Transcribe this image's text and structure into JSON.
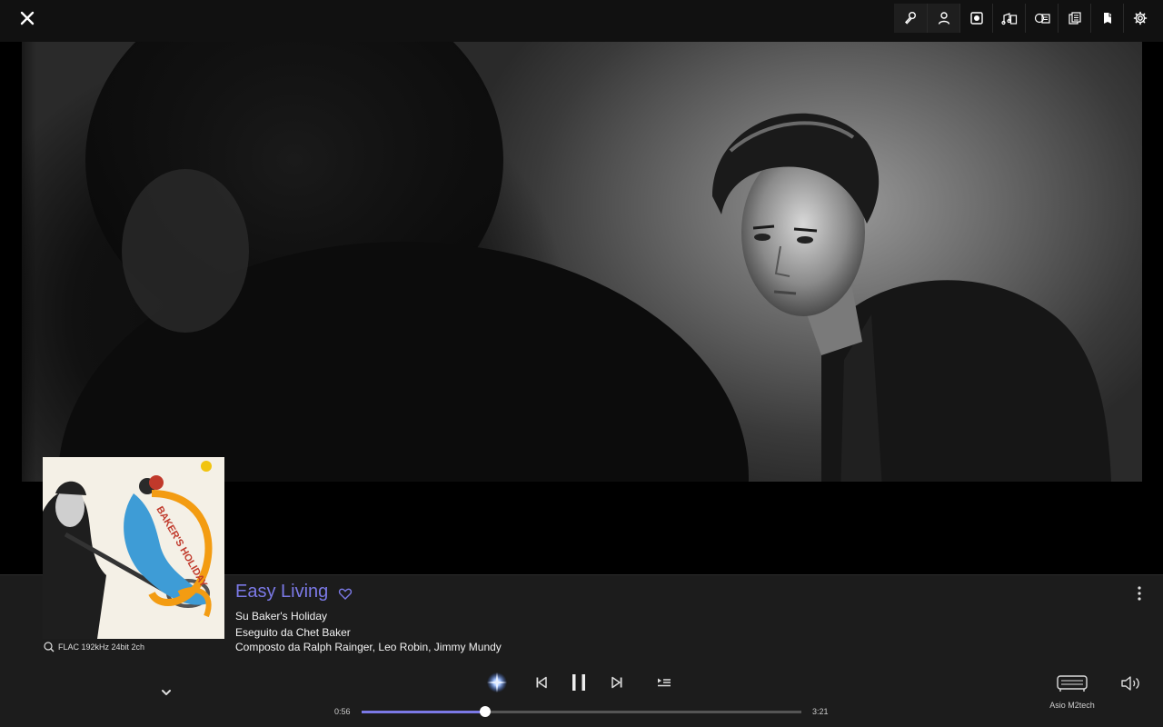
{
  "track": {
    "title": "Easy Living",
    "album_line": "Su Baker's Holiday",
    "performer_line": "Eseguito da Chet Baker",
    "composer_line": "Composto da Ralph Rainger, Leo Robin, Jimmy Mundy"
  },
  "quality": {
    "label": "FLAC 192kHz 24bit 2ch"
  },
  "playback": {
    "elapsed": "0:56",
    "duration": "3:21",
    "progress": 0.28
  },
  "output": {
    "label": "Asio M2tech"
  },
  "cover": {
    "art_text": "BAKER'S HOLIDAY"
  },
  "icons": {
    "close": "close-icon",
    "toolbar": [
      "microphone-icon",
      "person-icon",
      "album-icon",
      "music-notes-icon",
      "credits-icon",
      "lyrics-icon",
      "bookmark-icon",
      "gear-icon"
    ],
    "favorite": "heart-icon",
    "more": "more-vertical-icon",
    "collapse": "chevron-down-icon",
    "radio": "radio-sparkle-icon",
    "previous": "skip-previous-icon",
    "pause": "pause-icon",
    "next": "skip-next-icon",
    "queue": "queue-icon",
    "output": "speaker-output-icon",
    "volume": "volume-icon"
  },
  "colors": {
    "accent": "#7b79e6",
    "panel": "#1c1c1c",
    "topbar": "#111111"
  }
}
